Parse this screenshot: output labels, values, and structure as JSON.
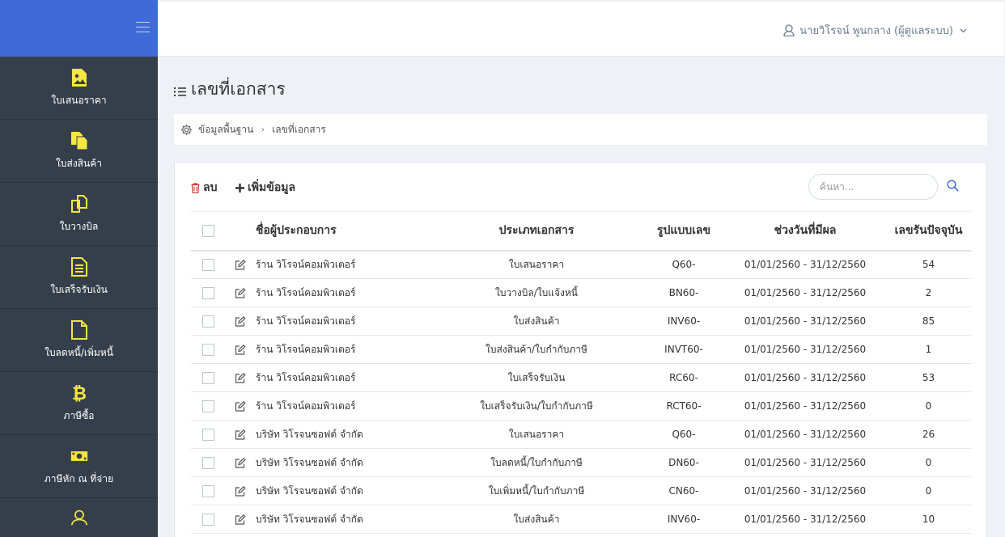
{
  "colors": {
    "sidebar_bg": "#353f4b",
    "sidebar_top": "#3f6ad8",
    "icon_yellow": "#f5e742",
    "link_blue": "#3f6ad8"
  },
  "sidebar": {
    "items": [
      {
        "label": "ใบเสนอราคา",
        "icon": "image-file-icon"
      },
      {
        "label": "ใบส่งสินค้า",
        "icon": "copy-files-icon"
      },
      {
        "label": "ใบวางบิล",
        "icon": "clone-icon"
      },
      {
        "label": "ใบเสร็จรับเงิน",
        "icon": "file-text-icon"
      },
      {
        "label": "ใบลดหนี้/เพิ่มหนี้",
        "icon": "blank-file-icon"
      },
      {
        "label": "ภาษีซื้อ",
        "icon": "bitcoin-icon"
      },
      {
        "label": "ภาษีหัก ณ ที่จ่าย",
        "icon": "money-bill-icon"
      }
    ]
  },
  "header": {
    "user_name": "นายวิโรจน์ พูนกลาง (ผู้ดูแลระบบ)"
  },
  "page": {
    "title": "เลขที่เอกสาร"
  },
  "breadcrumb": {
    "parent": "ข้อมูลพื้นฐาน",
    "current": "เลขที่เอกสาร"
  },
  "toolbar": {
    "delete_label": "ลบ",
    "add_label": "เพิ่มข้อมูล",
    "search_placeholder": "ค้นหา..."
  },
  "table": {
    "columns": [
      "ชื่อผู้ประกอบการ",
      "ประเภทเอกสาร",
      "รูปแบบเลข",
      "ช่วงวันที่มีผล",
      "เลขรันปัจจุบัน"
    ],
    "rows": [
      {
        "company": "ร้าน วิโรจน์คอมพิวเตอร์",
        "doc_type": "ใบเสนอราคา",
        "format": "Q60-",
        "period": "01/01/2560 - 31/12/2560",
        "current": "54"
      },
      {
        "company": "ร้าน วิโรจน์คอมพิวเตอร์",
        "doc_type": "ใบวางบิล/ใบแจ้งหนี้",
        "format": "BN60-",
        "period": "01/01/2560 - 31/12/2560",
        "current": "2"
      },
      {
        "company": "ร้าน วิโรจน์คอมพิวเตอร์",
        "doc_type": "ใบส่งสินค้า",
        "format": "INV60-",
        "period": "01/01/2560 - 31/12/2560",
        "current": "85"
      },
      {
        "company": "ร้าน วิโรจน์คอมพิวเตอร์",
        "doc_type": "ใบส่งสินค้า/ใบกำกับภาษี",
        "format": "INVT60-",
        "period": "01/01/2560 - 31/12/2560",
        "current": "1"
      },
      {
        "company": "ร้าน วิโรจน์คอมพิวเตอร์",
        "doc_type": "ใบเสร็จรับเงิน",
        "format": "RC60-",
        "period": "01/01/2560 - 31/12/2560",
        "current": "53"
      },
      {
        "company": "ร้าน วิโรจน์คอมพิวเตอร์",
        "doc_type": "ใบเสร็จรับเงิน/ใบกำกับภาษี",
        "format": "RCT60-",
        "period": "01/01/2560 - 31/12/2560",
        "current": "0"
      },
      {
        "company": "บริษัท วิโรจนซอฟต์ จำกัด",
        "doc_type": "ใบเสนอราคา",
        "format": "Q60-",
        "period": "01/01/2560 - 31/12/2560",
        "current": "26"
      },
      {
        "company": "บริษัท วิโรจนซอฟต์ จำกัด",
        "doc_type": "ใบลดหนี้/ใบกำกับภาษี",
        "format": "DN60-",
        "period": "01/01/2560 - 31/12/2560",
        "current": "0"
      },
      {
        "company": "บริษัท วิโรจนซอฟต์ จำกัด",
        "doc_type": "ใบเพิ่มหนี้/ใบกำกับภาษี",
        "format": "CN60-",
        "period": "01/01/2560 - 31/12/2560",
        "current": "0"
      },
      {
        "company": "บริษัท วิโรจนซอฟต์ จำกัด",
        "doc_type": "ใบส่งสินค้า",
        "format": "INV60-",
        "period": "01/01/2560 - 31/12/2560",
        "current": "10"
      }
    ]
  }
}
